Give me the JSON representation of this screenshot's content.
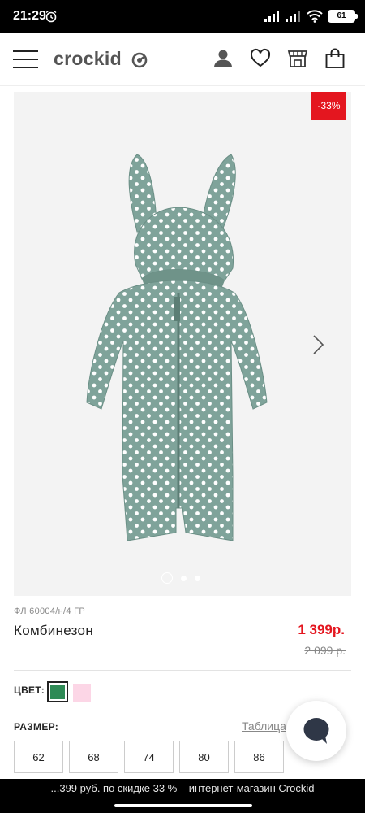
{
  "status_bar": {
    "time": "21:29",
    "battery": "61"
  },
  "header": {
    "logo_text": "crockid"
  },
  "gallery": {
    "discount": "-33%"
  },
  "product": {
    "sku": "ФЛ 60004/н/4 ГР",
    "name": "Комбинезон",
    "price": "1 399р.",
    "old_price": "2 099 р."
  },
  "colors": {
    "label": "ЦВЕТ:",
    "options": [
      "#2e8a55",
      "#fcd6e6"
    ],
    "selected": "#2e8a55"
  },
  "sizes": {
    "label": "РАЗМЕР:",
    "table_link": "Таблица",
    "options": [
      "62",
      "68",
      "74",
      "80",
      "86"
    ]
  },
  "bottom_bar": {
    "page_title": "...399 руб. по скидке 33 % – интернет-магазин Crockid"
  },
  "icons": {
    "menu": "hamburger-menu-icon",
    "account": "user-icon",
    "favorites": "heart-icon",
    "store": "store-icon",
    "cart": "shopping-bag-icon",
    "next": "chevron-right-icon",
    "chat": "chat-bubble-icon"
  }
}
